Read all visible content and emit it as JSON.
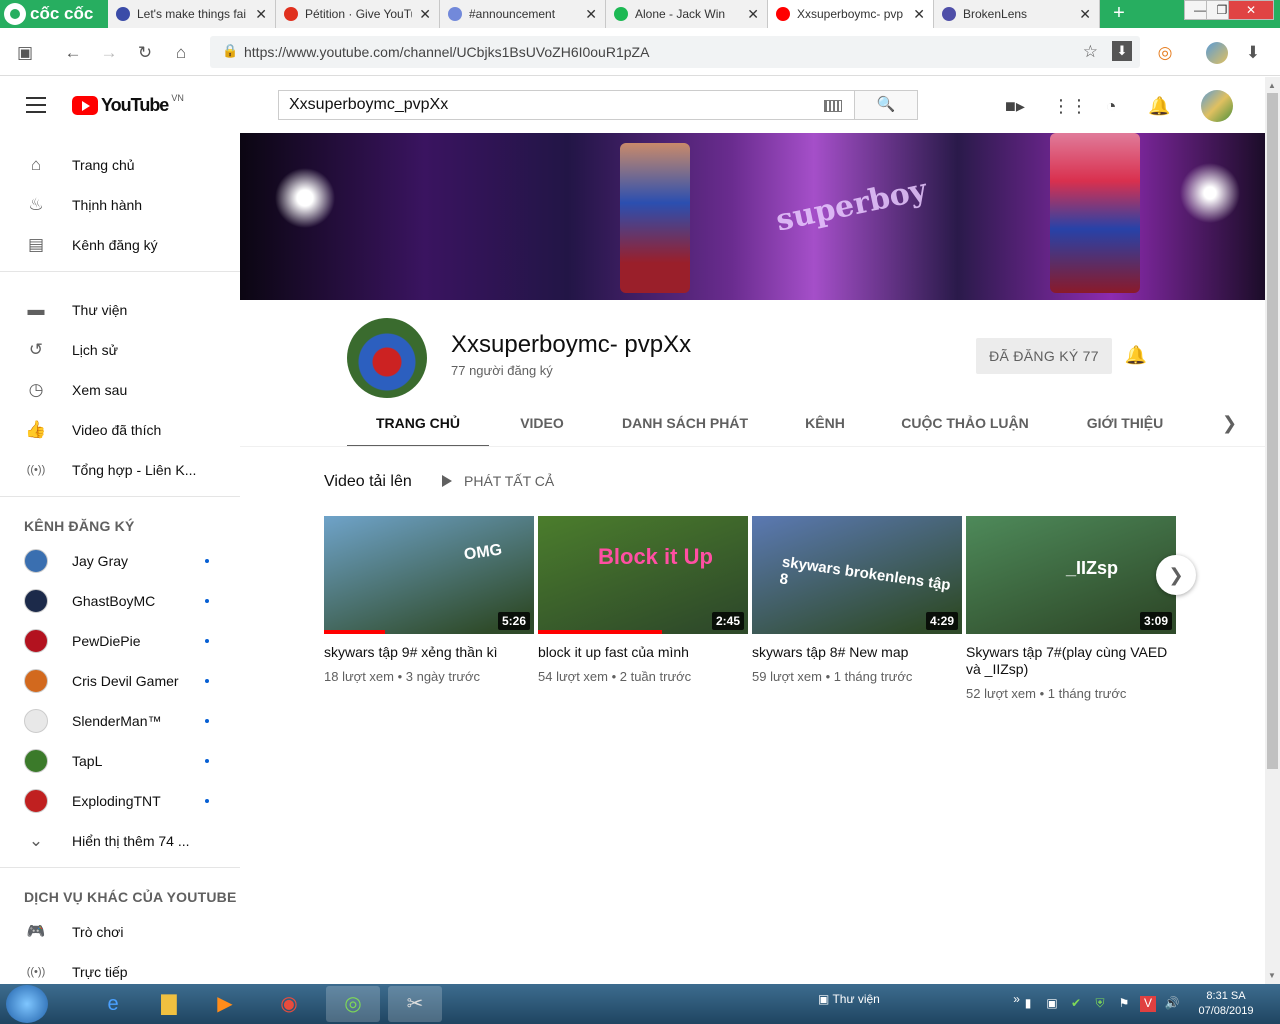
{
  "browser": {
    "brand": "cốc cốc",
    "tabs": [
      {
        "title": "Let's make things fai",
        "color": "#3b4ca8"
      },
      {
        "title": "Pétition · Give YouTu",
        "color": "#e0301e"
      },
      {
        "title": "#announcement",
        "color": "#7289da"
      },
      {
        "title": "Alone - Jack Win",
        "color": "#1db954"
      },
      {
        "title": "Xxsuperboymc- pvp",
        "color": "#ff0000"
      },
      {
        "title": "BrokenLens",
        "color": "#4f4fa8"
      }
    ],
    "url": "https://www.youtube.com/channel/UCbjks1BsUVoZH6I0ouR1pZA"
  },
  "header": {
    "logo": "YouTube",
    "country": "VN",
    "search_value": "Xxsuperboymc_pvpXx"
  },
  "sidebar": {
    "main": [
      {
        "label": "Trang chủ",
        "icon": "home-icon",
        "glyph": "⌂"
      },
      {
        "label": "Thịnh hành",
        "icon": "flame-icon",
        "glyph": "♨"
      },
      {
        "label": "Kênh đăng ký",
        "icon": "subscriptions-icon",
        "glyph": "▤"
      }
    ],
    "library": [
      {
        "label": "Thư viện",
        "icon": "folder-icon",
        "glyph": "▬"
      },
      {
        "label": "Lịch sử",
        "icon": "history-icon",
        "glyph": "↺"
      },
      {
        "label": "Xem sau",
        "icon": "clock-icon",
        "glyph": "◷"
      },
      {
        "label": "Video đã thích",
        "icon": "thumb-up-icon",
        "glyph": "👍"
      },
      {
        "label": "Tổng hợp - Liên K...",
        "icon": "broadcast-icon",
        "glyph": "((•))"
      }
    ],
    "subs_heading": "KÊNH ĐĂNG KÝ",
    "subscriptions": [
      {
        "label": "Jay Gray",
        "color": "#3a6fb0"
      },
      {
        "label": "GhastBoyMC",
        "color": "#1c2a4a"
      },
      {
        "label": "PewDiePie",
        "color": "#b3121f"
      },
      {
        "label": "Cris Devil Gamer",
        "color": "#d2691e"
      },
      {
        "label": "SlenderMan™",
        "color": "#e8e8e8"
      },
      {
        "label": "TapL",
        "color": "#3b7a2a"
      },
      {
        "label": "ExplodingTNT",
        "color": "#c02020"
      }
    ],
    "show_more": "Hiển thị thêm 74 ...",
    "services_heading": "DỊCH VỤ KHÁC CỦA YOUTUBE",
    "services": [
      {
        "label": "Trò chơi",
        "icon": "gamepad-icon",
        "glyph": "🎮"
      },
      {
        "label": "Trực tiếp",
        "icon": "live-icon",
        "glyph": "((•))"
      }
    ]
  },
  "channel": {
    "name": "Xxsuperboymc- pvpXx",
    "subscribers": "77 người đăng ký",
    "subscribe_label": "ĐÃ ĐĂNG KÝ  77",
    "banner_text": "superboy",
    "tabs": [
      "TRANG CHỦ",
      "VIDEO",
      "DANH SÁCH PHÁT",
      "KÊNH",
      "CUỘC THẢO LUẬN",
      "GIỚI THIỆU"
    ]
  },
  "uploads": {
    "heading": "Video tải lên",
    "play_all": "PHÁT TẤT CẢ",
    "videos": [
      {
        "title": "skywars tập 9# xẻng thần kì",
        "meta": "18 lượt xem • 3 ngày trước",
        "duration": "5:26",
        "overlay": "OMG",
        "progress": 0.29,
        "bg": "#6fa3c9"
      },
      {
        "title": "block it up fast của mình",
        "meta": "54 lượt xem • 2 tuần trước",
        "duration": "2:45",
        "overlay": "Block it Up",
        "progress": 0.59,
        "bg": "#4b7d2c"
      },
      {
        "title": "skywars tập 8# New map",
        "meta": "59 lượt xem • 1 tháng trước",
        "duration": "4:29",
        "overlay": "skywars brokenlens tập 8",
        "progress": 0.0,
        "bg": "#5b79b3"
      },
      {
        "title": "Skywars tập 7#(play cùng VAED và _IIZsp)",
        "meta": "52 lượt xem • 1 tháng trước",
        "duration": "3:09",
        "overlay": "_IIZsp",
        "progress": 0.0,
        "bg": "#4e8a5a"
      }
    ]
  },
  "taskbar": {
    "folder_label": "Thư viện",
    "time": "8:31 SA",
    "date": "07/08/2019"
  }
}
